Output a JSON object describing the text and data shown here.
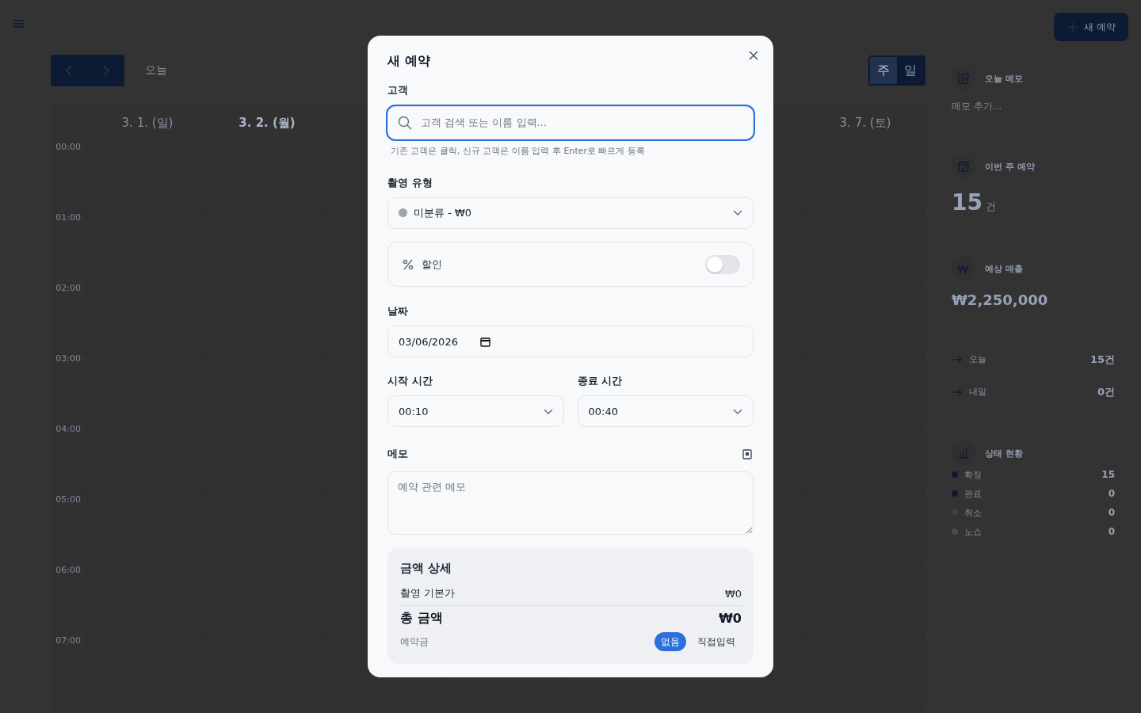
{
  "header": {
    "new_button": "새 예약"
  },
  "toolbar": {
    "today_button": "오늘",
    "views": [
      {
        "label": "주",
        "selected": true
      },
      {
        "label": "일",
        "selected": false
      }
    ]
  },
  "calendar": {
    "days": [
      {
        "label": "3. 1. (일)",
        "today": false
      },
      {
        "label": "3. 2. (월)",
        "today": true
      }
    ],
    "days_end": [
      {
        "label": "3. 7. (토)",
        "today": false
      }
    ],
    "hours": [
      "00:00",
      "01:00",
      "02:00",
      "03:00",
      "04:00",
      "05:00",
      "06:00",
      "07:00"
    ]
  },
  "sidebar": {
    "memo": {
      "title": "오늘 메모",
      "placeholder": "메모 추가..."
    },
    "week": {
      "title": "이번 주 예약",
      "count": "15",
      "unit": "건"
    },
    "sales": {
      "title": "예상 매출",
      "amount": "₩2,250,000"
    },
    "upcoming": [
      {
        "label": "오늘",
        "value": "15건"
      },
      {
        "label": "내일",
        "value": "0건"
      }
    ],
    "status": {
      "title": "상태 현황",
      "items": [
        {
          "label": "확정",
          "value": "15",
          "color": "#0c1a33"
        },
        {
          "label": "완료",
          "value": "0",
          "color": "#0c1a33"
        },
        {
          "label": "취소",
          "value": "0",
          "color": "#3c3f46"
        },
        {
          "label": "노쇼",
          "value": "0",
          "color": "#4a4d55"
        }
      ]
    }
  },
  "modal": {
    "title": "새 예약",
    "customer": {
      "label": "고객",
      "placeholder": "고객 검색 또는 이름 입력...",
      "hint": "기존 고객은 클릭, 신규 고객은 이름 입력 후 Enter로 빠르게 등록",
      "focused": true
    },
    "type": {
      "label": "촬영 유형",
      "value": "미분류 - ₩0",
      "color": "#9ca3af"
    },
    "discount": {
      "label": "할인",
      "on": false
    },
    "date": {
      "label": "날짜",
      "value": "03/06/2026"
    },
    "start": {
      "label": "시작 시간",
      "value": "00:10"
    },
    "end": {
      "label": "종료 시간",
      "value": "00:40"
    },
    "memo": {
      "label": "메모",
      "placeholder": "예약 관련 메모"
    },
    "summary": {
      "title": "금액 상세",
      "base_label": "촬영 기본가",
      "base_value": "₩0",
      "total_label": "총 금액",
      "total_value": "₩0",
      "deposit_label": "예약금",
      "deposit_options": [
        {
          "label": "없음",
          "selected": true
        },
        {
          "label": "직접입력",
          "selected": false
        }
      ]
    }
  }
}
